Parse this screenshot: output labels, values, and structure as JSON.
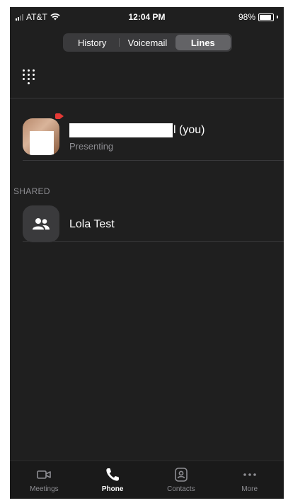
{
  "status_bar": {
    "carrier": "AT&T",
    "time": "12:04 PM",
    "battery": "98%",
    "battery_level": 0.98
  },
  "segment": {
    "items": [
      "History",
      "Voicemail",
      "Lines"
    ],
    "active": "Lines"
  },
  "self_line": {
    "name_suffix": "l (you)",
    "status": "Presenting"
  },
  "shared": {
    "section_label": "SHARED",
    "items": [
      {
        "name": "Lola Test"
      }
    ]
  },
  "tabbar": {
    "items": [
      "Meetings",
      "Phone",
      "Contacts",
      "More"
    ],
    "active": "Phone"
  },
  "colors": {
    "background": "#1f1f1f",
    "badge_red": "#e53935",
    "secondary_text": "#8e8e93"
  }
}
